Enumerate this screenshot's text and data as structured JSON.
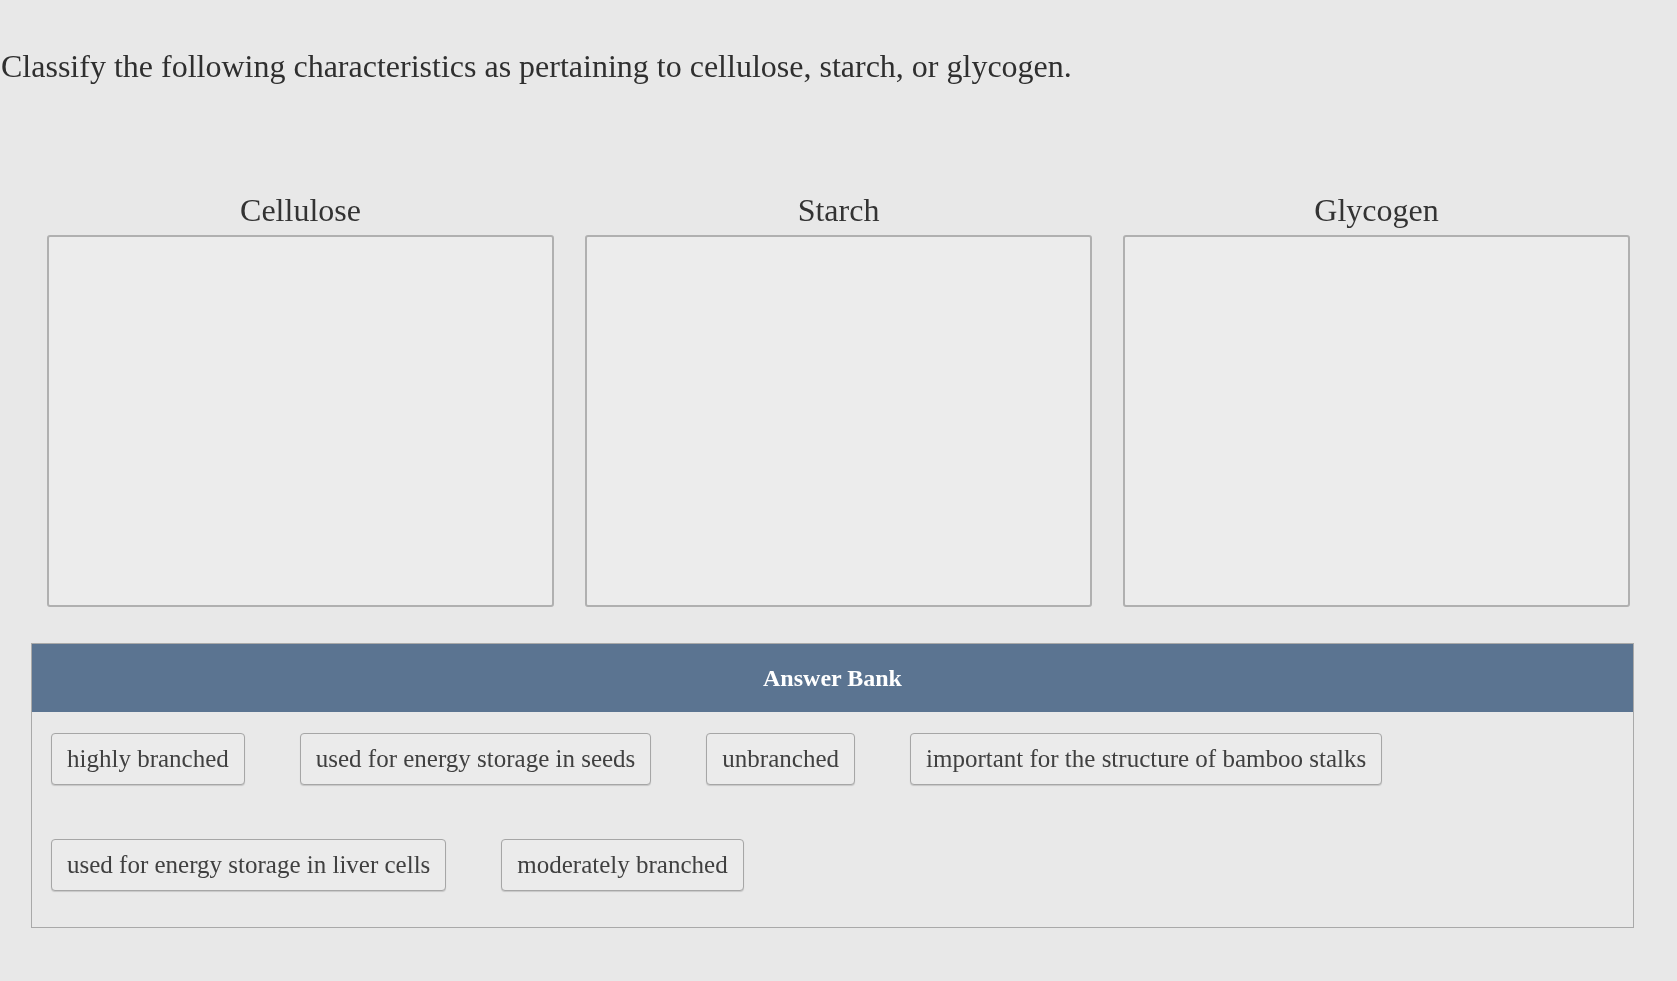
{
  "prompt": "Classify the following characteristics as pertaining to cellulose, starch, or glycogen.",
  "categories": [
    {
      "label": "Cellulose"
    },
    {
      "label": "Starch"
    },
    {
      "label": "Glycogen"
    }
  ],
  "answer_bank": {
    "title": "Answer Bank",
    "items": [
      "highly branched",
      "used for energy storage in seeds",
      "unbranched",
      "important for the structure of bamboo stalks",
      "used for energy storage in liver cells",
      "moderately branched"
    ]
  }
}
